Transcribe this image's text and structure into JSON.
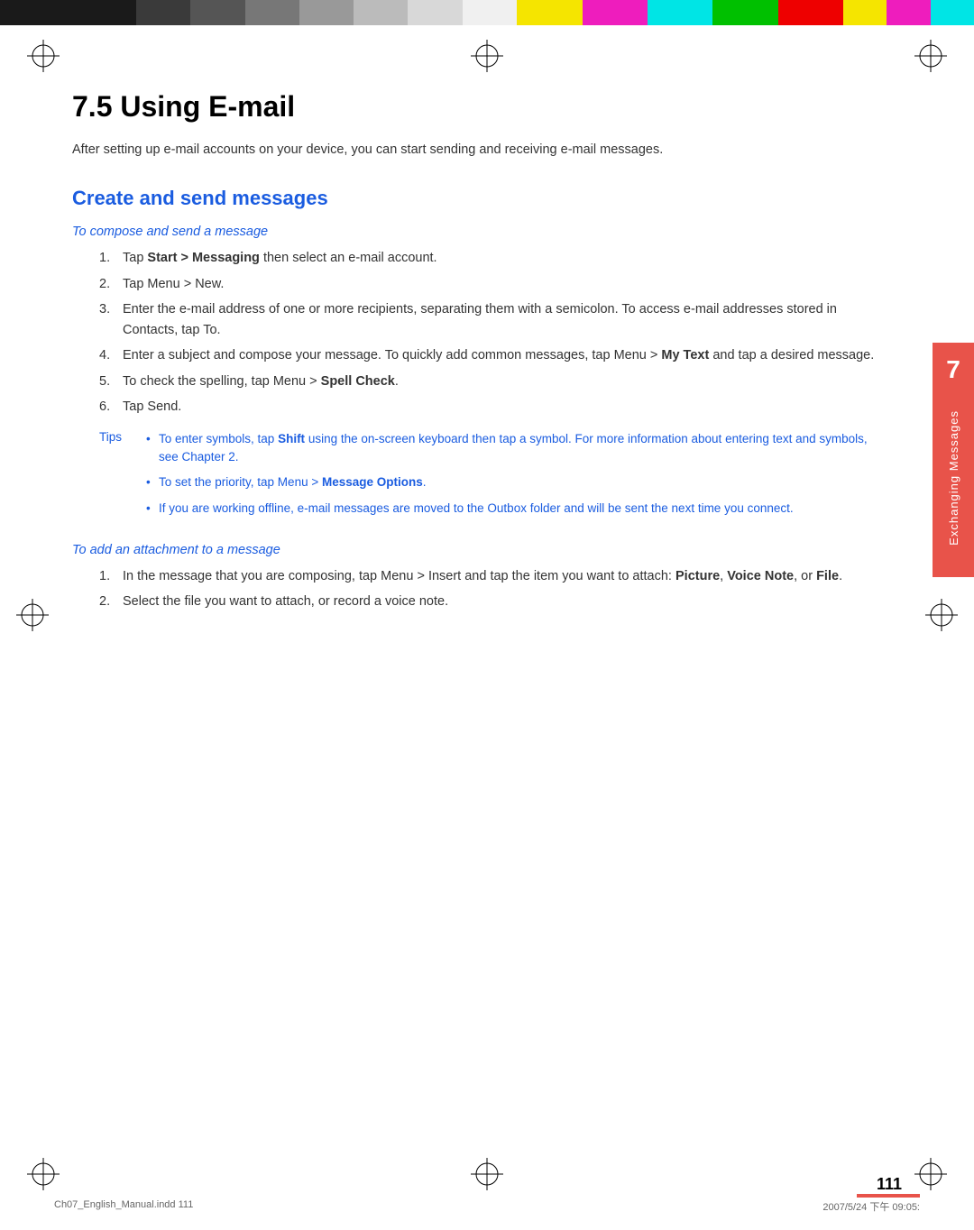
{
  "colorBar": {
    "segments": [
      {
        "color": "#1a1a1a",
        "flex": 2
      },
      {
        "color": "#3a3a3a",
        "flex": 1
      },
      {
        "color": "#555555",
        "flex": 1
      },
      {
        "color": "#777777",
        "flex": 1
      },
      {
        "color": "#999999",
        "flex": 1
      },
      {
        "color": "#bbbbbb",
        "flex": 1
      },
      {
        "color": "#dddddd",
        "flex": 1
      },
      {
        "color": "#ffffff",
        "flex": 1
      },
      {
        "color": "#f5e500",
        "flex": 1
      },
      {
        "color": "#ee1dbd",
        "flex": 1
      },
      {
        "color": "#00e5e5",
        "flex": 1
      },
      {
        "color": "#00c000",
        "flex": 1
      },
      {
        "color": "#ee0000",
        "flex": 1
      },
      {
        "color": "#f5e500",
        "flex": 1
      },
      {
        "color": "#ee1dbd",
        "flex": 1
      },
      {
        "color": "#00e5e5",
        "flex": 1
      }
    ]
  },
  "page": {
    "sectionNumber": "7.5",
    "sectionTitle": "Using E-mail",
    "introText": "After setting up e-mail accounts on your device, you can start sending and receiving e-mail messages.",
    "subsectionTitle": "Create and send messages",
    "compose": {
      "subheading": "To compose and send a message",
      "steps": [
        "Tap Start > Messaging then select an e-mail account.",
        "Tap Menu > New.",
        "Enter the e-mail address of one or more recipients, separating them with a semicolon. To access e-mail addresses stored in Contacts, tap To.",
        "Enter a subject and compose your message. To quickly add common messages, tap Menu > My Text and tap a desired message.",
        "To check the spelling, tap Menu > Spell Check.",
        "Tap Send."
      ],
      "tips": {
        "label": "Tips",
        "items": [
          "To enter symbols, tap Shift using the on-screen keyboard then tap a symbol. For more information about entering text and symbols, see Chapter 2.",
          "To set the priority, tap Menu > Message Options.",
          "If you are working offline, e-mail messages are moved to the Outbox folder and will be sent the next time you connect."
        ]
      }
    },
    "attachment": {
      "subheading": "To add an attachment to a message",
      "steps": [
        "In the message that you are composing, tap Menu > Insert and tap the item you want to attach: Picture, Voice Note, or File.",
        "Select the file you want to attach, or record a voice note."
      ]
    },
    "chapterTab": {
      "number": "7",
      "title": "Exchanging Messages"
    },
    "pageNumber": "111",
    "footer": {
      "left": "Ch07_English_Manual.indd    111",
      "right": "2007/5/24    下午 09:05:"
    }
  }
}
